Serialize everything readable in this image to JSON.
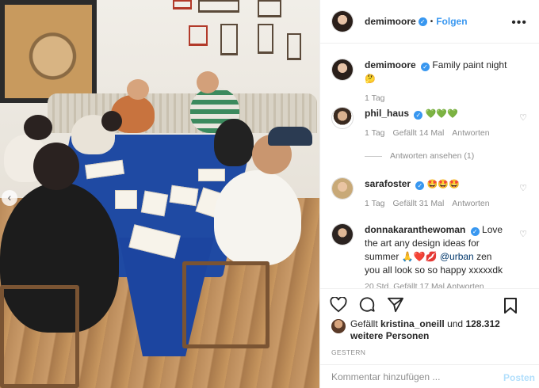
{
  "photo": {
    "alt_scene": ""
  },
  "header": {
    "username": "demimoore",
    "dot": "•",
    "follow_label": "Folgen",
    "more_icon": "more-dots-icon"
  },
  "caption": {
    "username": "demimoore",
    "text": "Family paint night",
    "emoji": "🤔",
    "time": "1 Tag"
  },
  "comments": [
    {
      "username": "phil_haus",
      "text": "💚💚💚",
      "time": "1 Tag",
      "likes": "Gefällt 14 Mal",
      "reply": "Antworten",
      "view_replies": "Antworten ansehen (1)"
    },
    {
      "username": "sarafoster",
      "text": "🤩🤩🤩",
      "time": "1 Tag",
      "likes": "Gefällt 31 Mal",
      "reply": "Antworten"
    },
    {
      "username": "donnakaranthewoman",
      "text_part1": "Love the art any design ideas for summer 🙏❤️💋",
      "mention": "@urban",
      "text_part2": "zen you all look so so happy xxxxxdk",
      "meta_clipped": "20 Std. Gefällt 17 Mal Antworten"
    }
  ],
  "actions": {
    "like_icon": "heart-icon",
    "comment_icon": "comment-icon",
    "share_icon": "share-icon",
    "save_icon": "bookmark-icon"
  },
  "likes": {
    "prefix": "Gefällt",
    "user": "kristina_oneill",
    "middle": "und",
    "count": "128.312 weitere Personen"
  },
  "date": "GESTERN",
  "add_comment": {
    "placeholder": "Kommentar hinzufügen ...",
    "post_label": "Posten"
  },
  "colors": {
    "accent": "#3897f0",
    "verified": "#3897f0",
    "post_disabled": "#b2dffc"
  }
}
